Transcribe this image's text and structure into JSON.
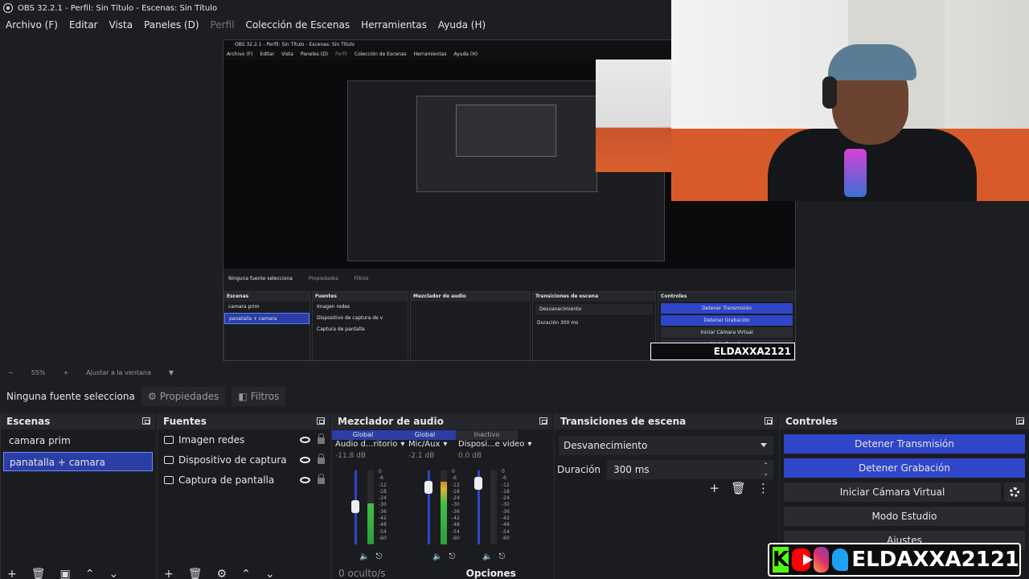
{
  "window": {
    "title": "OBS 32.2.1 - Perfil: Sin Título - Escenas: Sin Título"
  },
  "menu": {
    "items": [
      "Archivo (F)",
      "Editar",
      "Vista",
      "Paneles (D)",
      "Perfil",
      "Colección de Escenas",
      "Herramientas",
      "Ayuda (H)"
    ]
  },
  "status": {
    "zoom": "55%",
    "fit": "Ajustar a la ventana"
  },
  "source_bar": {
    "no_source": "Ninguna fuente selecciona",
    "properties": "Propiedades",
    "filters": "Filtros"
  },
  "scenes": {
    "title": "Escenas",
    "items": [
      "camara prim",
      "panatalla + camara"
    ]
  },
  "sources": {
    "title": "Fuentes",
    "items": [
      "Imagen redes",
      "Dispositivo de captura de v",
      "Captura de pantalla"
    ]
  },
  "mixer": {
    "title": "Mezclador de audio",
    "tabs": [
      "Global",
      "Global",
      "Inactivo"
    ],
    "channels": [
      {
        "name": "Audio d...ritorio",
        "db": "-11.8 dB",
        "level": 0.55,
        "fader": 0.55
      },
      {
        "name": "Mic/Aux",
        "db": "-2.1 dB",
        "level": 0.85,
        "fader": 0.82
      },
      {
        "name": "Disposi...e video",
        "db": "0.0 dB",
        "level": 0.0,
        "fader": 0.87
      }
    ],
    "scale": [
      "0",
      "-6",
      "-12",
      "-18",
      "-24",
      "-30",
      "-36",
      "-42",
      "-48",
      "-54",
      "-60"
    ],
    "footer_hidden": "0 oculto/s",
    "footer_options": "Opciones"
  },
  "transitions": {
    "title": "Transiciones de escena",
    "selected": "Desvanecimiento",
    "duration_label": "Duración",
    "duration_value": "300 ms"
  },
  "controls": {
    "title": "Controles",
    "stop_stream": "Detener Transmisión",
    "stop_record": "Detener Grabación",
    "virtual_cam": "Iniciar Cámara Virtual",
    "studio_mode": "Modo Estudio",
    "settings": "Ajustes"
  },
  "nested_preview": {
    "title": "OBS 32.2.1 - Perfil: Sin Título - Escenas: Sin Título",
    "no_source": "Ninguna fuente selecciona",
    "properties": "Propiedades",
    "filters": "Filtros",
    "zoom": "55%",
    "fit": "Ajustar a la ventana"
  },
  "brand": {
    "handle": "ELDAXXA2121",
    "kick_letter": "K"
  },
  "colors": {
    "accent": "#2f46c8",
    "selection": "#2a3ea6",
    "panel": "#1b1c20",
    "header": "#26272c"
  }
}
